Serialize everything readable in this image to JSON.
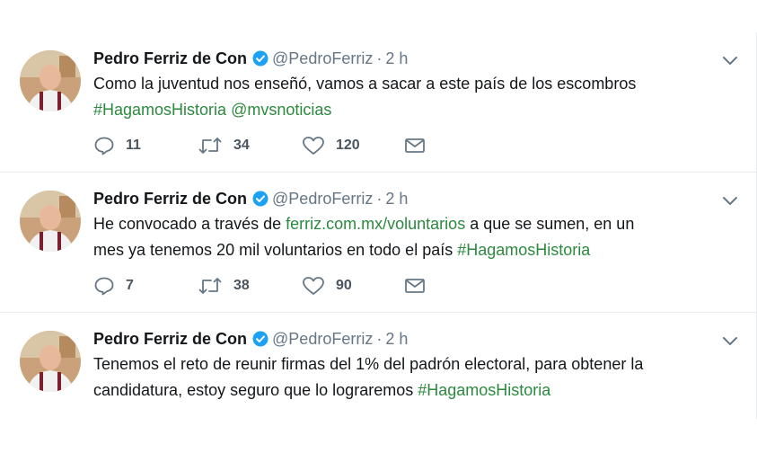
{
  "colors": {
    "accent": "#2b8a3e",
    "verified": "#1da1f2",
    "muted": "#657786"
  },
  "tweets": [
    {
      "author": "Pedro Ferriz de Con",
      "handle": "@PedroFerriz",
      "sep": "·",
      "time": "2 h",
      "line1": "Como la juventud nos enseñó, vamos a sacar a este país de los escombros",
      "tag": "#HagamosHistoria",
      "mention": "@mvsnoticias",
      "replies": "11",
      "retweets": "34",
      "likes": "120"
    },
    {
      "author": "Pedro Ferriz de Con",
      "handle": "@PedroFerriz",
      "sep": "·",
      "time": "2 h",
      "pre": "He convocado a través de ",
      "url": "ferriz.com.mx/voluntarios",
      "post": " a que se sumen, en un",
      "line2": "mes ya tenemos 20 mil voluntarios en todo el país ",
      "tag": "#HagamosHistoria",
      "replies": "7",
      "retweets": "38",
      "likes": "90"
    },
    {
      "author": "Pedro Ferriz de Con",
      "handle": "@PedroFerriz",
      "sep": "·",
      "time": "2 h",
      "line1": "Tenemos el reto de reunir firmas del 1% del padrón electoral, para obtener la",
      "line2": "candidatura, estoy seguro que lo lograremos ",
      "tag": "#HagamosHistoria"
    }
  ]
}
